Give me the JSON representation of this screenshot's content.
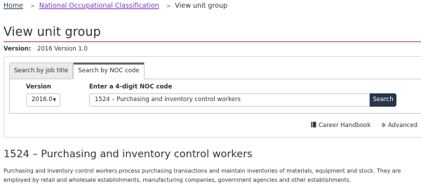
{
  "breadcrumb": {
    "items": [
      "Home",
      "National Occupational Classification",
      "View unit group"
    ],
    "separator": ">"
  },
  "page": {
    "title": "View unit group",
    "version_label": "Version:",
    "version_value": "2016 Version 1.0"
  },
  "tabs": [
    {
      "label": "Search by job title",
      "active": false
    },
    {
      "label": "Search by NOC code",
      "active": true
    }
  ],
  "form": {
    "version_label": "Version",
    "version_selected": "2016.0",
    "noc_label": "Enter a 4-digit NOC code",
    "noc_value": "1524 – Purchasing and inventory control workers",
    "search_label": "Search"
  },
  "tools": {
    "career_handbook": "Career Handbook",
    "advanced": "Advanced"
  },
  "unit_group": {
    "title": "1524 – Purchasing and inventory control workers",
    "description": "Purchasing and inventory control workers process purchasing transactions and maintain inventories of materials, equipment and stock. They are employed by retail and wholesale establishments, manufacturing companies, government agencies and other establishments."
  },
  "colors": {
    "link": "#284162",
    "visited_link": "#7834bc",
    "title_rule": "#af3c43",
    "search_button": "#26374a"
  }
}
